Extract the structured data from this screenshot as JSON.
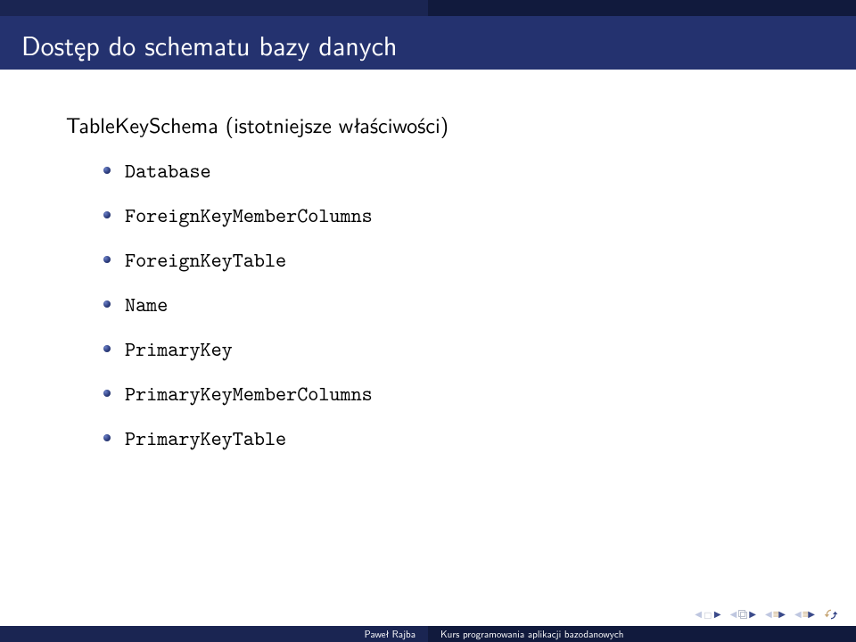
{
  "header": {
    "title": "Dostęp do schematu bazy danych"
  },
  "body": {
    "subtitle": "TableKeySchema (istotniejsze właściwości)",
    "items": [
      "Database",
      "ForeignKeyMemberColumns",
      "ForeignKeyTable",
      "Name",
      "PrimaryKey",
      "PrimaryKeyMemberColumns",
      "PrimaryKeyTable"
    ]
  },
  "footer": {
    "author": "Paweł Rajba",
    "course": "Kurs programowania aplikacji bazodanowych"
  }
}
